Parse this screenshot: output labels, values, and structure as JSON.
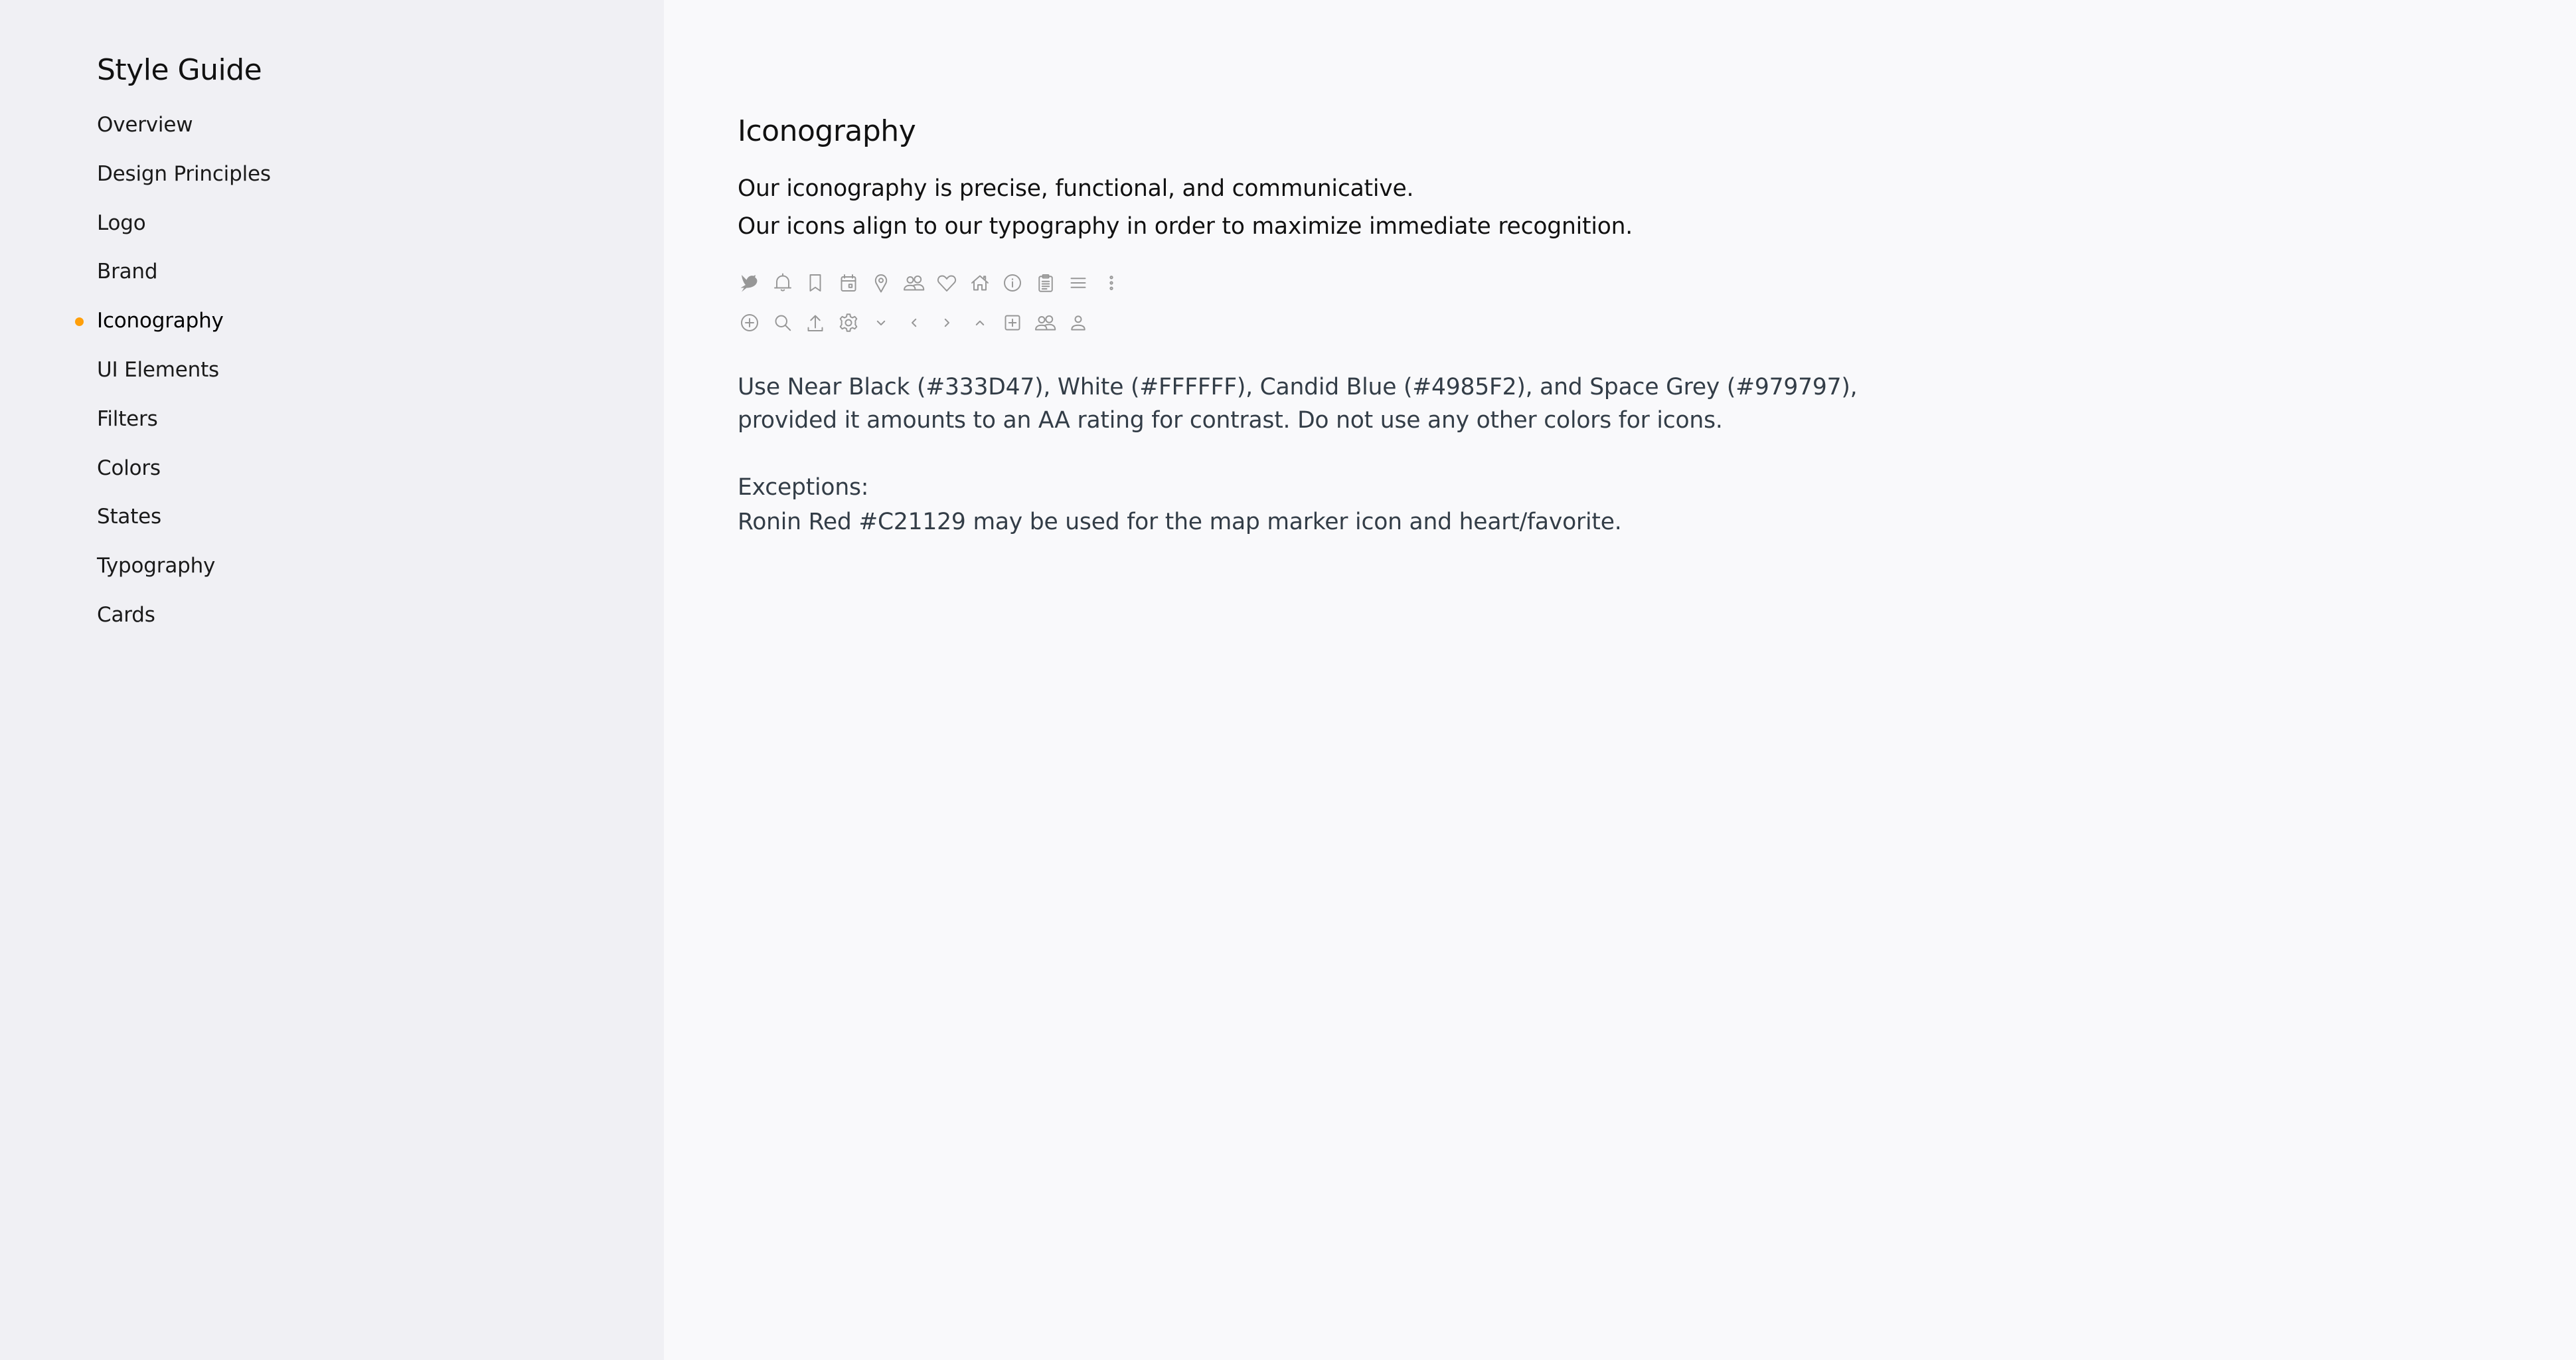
{
  "sidebar": {
    "title": "Style Guide",
    "active_color": "#FF9F0A",
    "items": [
      {
        "label": "Overview",
        "active": false
      },
      {
        "label": "Design Principles",
        "active": false
      },
      {
        "label": "Logo",
        "active": false
      },
      {
        "label": "Brand",
        "active": false
      },
      {
        "label": "Iconography",
        "active": true
      },
      {
        "label": "UI Elements",
        "active": false
      },
      {
        "label": "Filters",
        "active": false
      },
      {
        "label": "Colors",
        "active": false
      },
      {
        "label": "States",
        "active": false
      },
      {
        "label": "Typography",
        "active": false
      },
      {
        "label": "Cards",
        "active": false
      }
    ]
  },
  "main": {
    "title": "Iconography",
    "intro": [
      "Our iconography is precise, functional, and communicative.",
      "Our icons align to our typography in order to maximize immediate recognition."
    ],
    "icon_color": "#979797",
    "icons_row1": [
      "bird-logo-icon",
      "bell-icon",
      "bookmark-icon",
      "calendar-icon",
      "map-marker-icon",
      "group-icon",
      "heart-icon",
      "home-icon",
      "info-icon",
      "clipboard-icon",
      "menu-icon",
      "more-vertical-icon"
    ],
    "icons_row2": [
      "add-circle-icon",
      "search-icon",
      "upload-icon",
      "gear-icon",
      "chevron-down-icon",
      "chevron-left-icon",
      "chevron-right-icon",
      "chevron-up-icon",
      "add-square-icon",
      "group-icon",
      "user-icon"
    ],
    "colors_paragraph": "Use Near Black (#333D47), White (#FFFFFF), Candid Blue (#4985F2), and Space Grey (#979797), provided it amounts to an AA rating for contrast. Do not use any other colors for icons.",
    "exceptions_label": "Exceptions:",
    "exceptions_text": "Ronin Red #C21129 may be used for the map marker icon and heart/favorite.",
    "palette": {
      "near_black": "#333D47",
      "white": "#FFFFFF",
      "candid_blue": "#4985F2",
      "space_grey": "#979797",
      "ronin_red": "#C21129"
    }
  }
}
